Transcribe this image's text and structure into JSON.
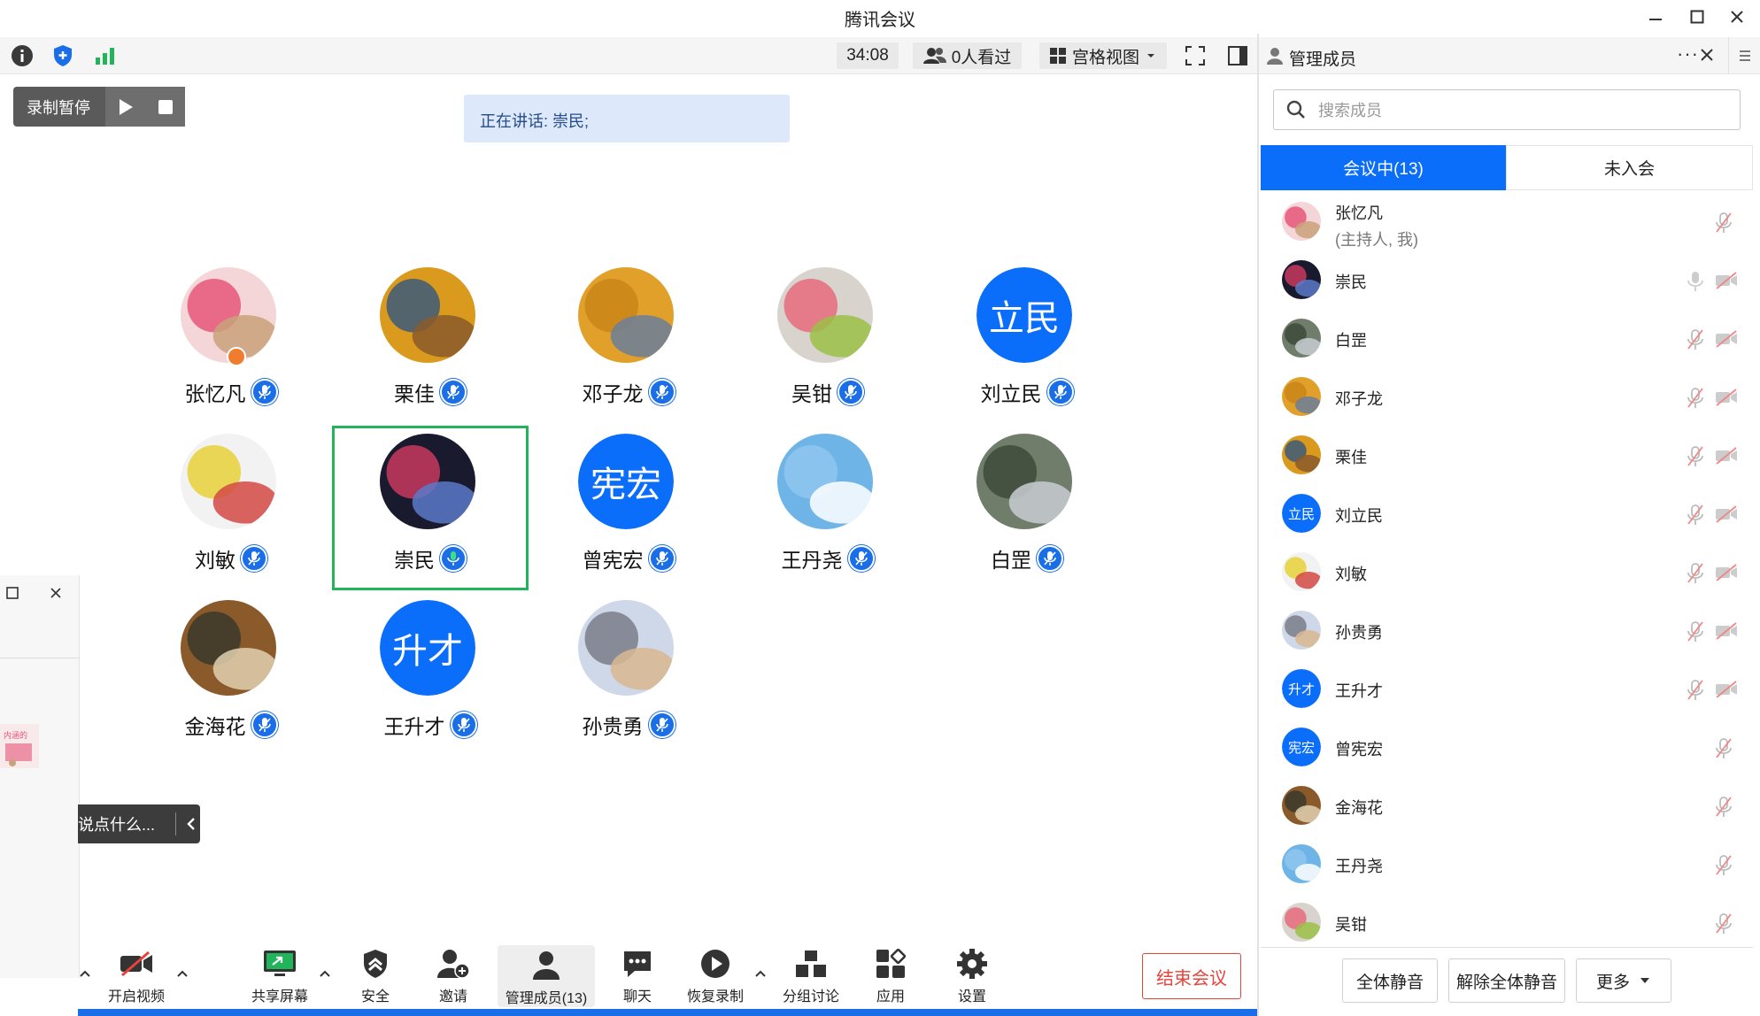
{
  "window": {
    "title": "腾讯会议"
  },
  "toolbar": {
    "timer": "34:08",
    "viewers": "0人看过",
    "view_mode": "宫格视图"
  },
  "panel": {
    "title": "管理成员",
    "search_placeholder": "搜索成员",
    "tab_in_meeting": "会议中(13)",
    "tab_not_joined": "未入会",
    "mute_all": "全体静音",
    "unmute_all": "解除全体静音",
    "more": "更多"
  },
  "recording": {
    "label": "录制暂停"
  },
  "speaking": {
    "text": "正在讲话: 崇民;"
  },
  "tiles": [
    {
      "name": "张忆凡",
      "avatar": "image",
      "colors": [
        "#f5d6d8",
        "#e6577a",
        "#c9a27a"
      ]
    },
    {
      "name": "栗佳",
      "avatar": "image",
      "colors": [
        "#d99a1e",
        "#3c5b7a",
        "#8a5a2b"
      ]
    },
    {
      "name": "邓子龙",
      "avatar": "image",
      "colors": [
        "#e0a02a",
        "#c98518",
        "#6b7f9a"
      ]
    },
    {
      "name": "吴钳",
      "avatar": "image",
      "colors": [
        "#d8d3cc",
        "#e86a7c",
        "#9bbf46"
      ]
    },
    {
      "name": "刘立民",
      "avatar": "text",
      "text": "立民"
    },
    {
      "name": "刘敏",
      "avatar": "image",
      "colors": [
        "#f2f2f2",
        "#e8d13a",
        "#d44a44"
      ]
    },
    {
      "name": "崇民",
      "avatar": "image",
      "colors": [
        "#1a1a2e",
        "#c83a5e",
        "#5a7ac8"
      ]
    },
    {
      "name": "曾宪宏",
      "avatar": "text",
      "text": "宪宏"
    },
    {
      "name": "王丹尧",
      "avatar": "image",
      "colors": [
        "#6fb4e6",
        "#8fc6ee",
        "#ffffff"
      ]
    },
    {
      "name": "白罡",
      "avatar": "image",
      "colors": [
        "#6f7d6a",
        "#3e4a3a",
        "#c9ccd2"
      ]
    },
    {
      "name": "金海花",
      "avatar": "image",
      "colors": [
        "#8a5a2b",
        "#3a3a2a",
        "#e0d0b0"
      ]
    },
    {
      "name": "王升才",
      "avatar": "text",
      "text": "升才"
    },
    {
      "name": "孙贵勇",
      "avatar": "image",
      "colors": [
        "#cfd8e8",
        "#7a7e88",
        "#d8b890"
      ]
    }
  ],
  "members": [
    {
      "name": "张忆凡",
      "sub": "(主持人, 我)",
      "avatar": "image",
      "colors": [
        "#f5d6d8",
        "#e6577a",
        "#c9a27a"
      ],
      "mic": "off",
      "cam": "none"
    },
    {
      "name": "崇民",
      "avatar": "image",
      "colors": [
        "#1a1a2e",
        "#c83a5e",
        "#5a7ac8"
      ],
      "mic": "on",
      "cam": "off"
    },
    {
      "name": "白罡",
      "avatar": "image",
      "colors": [
        "#6f7d6a",
        "#3e4a3a",
        "#c9ccd2"
      ],
      "mic": "off",
      "cam": "off"
    },
    {
      "name": "邓子龙",
      "avatar": "image",
      "colors": [
        "#e0a02a",
        "#c98518",
        "#6b7f9a"
      ],
      "mic": "off",
      "cam": "off"
    },
    {
      "name": "栗佳",
      "avatar": "image",
      "colors": [
        "#d99a1e",
        "#3c5b7a",
        "#8a5a2b"
      ],
      "mic": "off",
      "cam": "off"
    },
    {
      "name": "刘立民",
      "avatar": "text",
      "text": "立民",
      "mic": "off",
      "cam": "off"
    },
    {
      "name": "刘敏",
      "avatar": "image",
      "colors": [
        "#f2f2f2",
        "#e8d13a",
        "#d44a44"
      ],
      "mic": "off",
      "cam": "off"
    },
    {
      "name": "孙贵勇",
      "avatar": "image",
      "colors": [
        "#cfd8e8",
        "#7a7e88",
        "#d8b890"
      ],
      "mic": "off",
      "cam": "off"
    },
    {
      "name": "王升才",
      "avatar": "text",
      "text": "升才",
      "mic": "off",
      "cam": "off"
    },
    {
      "name": "曾宪宏",
      "avatar": "text",
      "text": "宪宏",
      "mic": "off",
      "cam": "none"
    },
    {
      "name": "金海花",
      "avatar": "image",
      "colors": [
        "#8a5a2b",
        "#3a3a2a",
        "#e0d0b0"
      ],
      "mic": "off",
      "cam": "none"
    },
    {
      "name": "王丹尧",
      "avatar": "image",
      "colors": [
        "#6fb4e6",
        "#8fc6ee",
        "#ffffff"
      ],
      "mic": "off",
      "cam": "none"
    },
    {
      "name": "吴钳",
      "avatar": "image",
      "colors": [
        "#d8d3cc",
        "#e86a7c",
        "#9bbf46"
      ],
      "mic": "off",
      "cam": "none"
    }
  ],
  "sidebar_chat": {
    "placeholder": "说点什么..."
  },
  "bottom": {
    "video": "开启视频",
    "share": "共享屏幕",
    "security": "安全",
    "invite": "邀请",
    "members": "管理成员(13)",
    "chat": "聊天",
    "resume_record": "恢复录制",
    "breakout": "分组讨论",
    "apps": "应用",
    "settings": "设置",
    "end": "结束会议"
  },
  "colors": {
    "accent": "#0b6efb",
    "end": "#e8433a",
    "active": "#22b45a"
  }
}
